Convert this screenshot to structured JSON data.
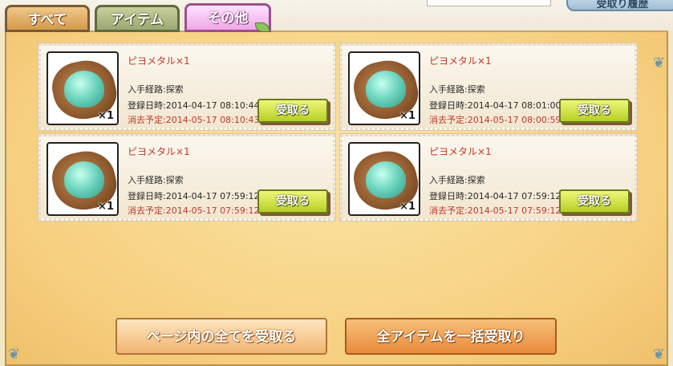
{
  "header": {
    "history_button_label": "受取り履歴"
  },
  "tabs": [
    {
      "label": "すべて"
    },
    {
      "label": "アイテム"
    },
    {
      "label": "その他"
    }
  ],
  "items": [
    {
      "name": "ピヨメタル×1",
      "quantity": "×1",
      "route": "入手経路:探索",
      "registered": "登録日時:2014-04-17 08:10:44",
      "expires": "消去予定:2014-05-17 08:10:43",
      "receive_label": "受取る"
    },
    {
      "name": "ピヨメタル×1",
      "quantity": "×1",
      "route": "入手経路:探索",
      "registered": "登録日時:2014-04-17 08:01:00",
      "expires": "消去予定:2014-05-17 08:00:59",
      "receive_label": "受取る"
    },
    {
      "name": "ピヨメタル×1",
      "quantity": "×1",
      "route": "入手経路:探索",
      "registered": "登録日時:2014-04-17 07:59:12",
      "expires": "消去予定:2014-05-17 07:59:12",
      "receive_label": "受取る"
    },
    {
      "name": "ピヨメタル×1",
      "quantity": "×1",
      "route": "入手経路:探索",
      "registered": "登録日時:2014-04-17 07:59:12",
      "expires": "消去予定:2014-05-17 07:59:12",
      "receive_label": "受取る"
    }
  ],
  "footer": {
    "receive_page_label": "ページ内の全てを受取る",
    "receive_all_label": "全アイテムを一括受取り"
  },
  "colors": {
    "accent_red": "#c0392b",
    "receive_green": "#b7cf23",
    "panel_bg": "#f6cf7f"
  }
}
